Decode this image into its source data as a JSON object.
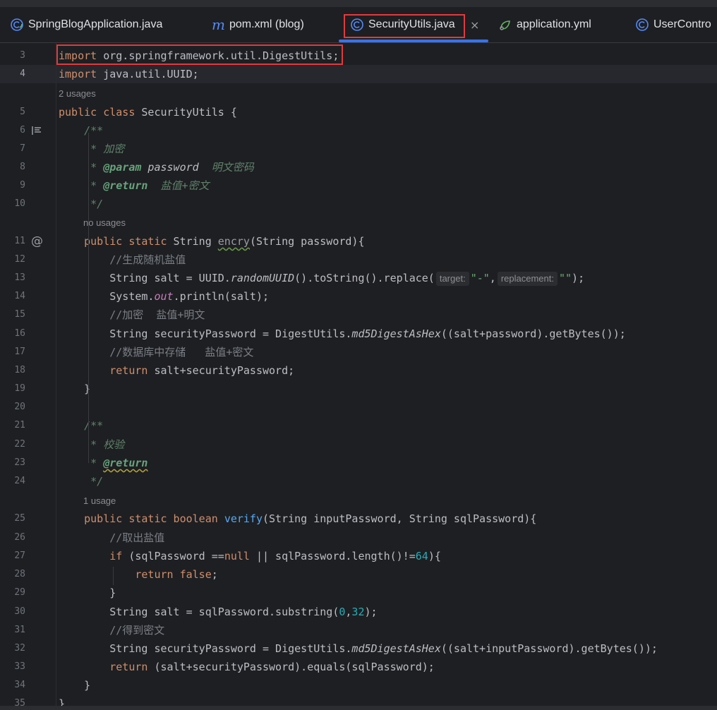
{
  "tabs": [
    {
      "label": "SpringBlogApplication.java",
      "icon": "spring-class-icon"
    },
    {
      "label": "pom.xml (blog)",
      "icon": "maven-m-icon"
    },
    {
      "label": "SecurityUtils.java",
      "icon": "class-icon",
      "active": true,
      "close": "×"
    },
    {
      "label": "application.yml",
      "icon": "spring-leaf-icon"
    },
    {
      "label": "UserContro",
      "icon": "class-icon"
    }
  ],
  "colors": {
    "accent": "#3574f0",
    "highlight": "#e03a3e",
    "keyword": "#cf8e6d",
    "comment": "#7a7e85",
    "doc": "#5f826b",
    "method": "#56a8f5",
    "number": "#2aacb8",
    "string": "#6aab73"
  },
  "lines": {
    "l3": "3",
    "l4": "4",
    "l5": "5",
    "l6": "6",
    "l7": "7",
    "l8": "8",
    "l9": "9",
    "l10": "10",
    "l11": "11",
    "l12": "12",
    "l13": "13",
    "l14": "14",
    "l15": "15",
    "l16": "16",
    "l17": "17",
    "l18": "18",
    "l19": "19",
    "l20": "20",
    "l21": "21",
    "l22": "22",
    "l23": "23",
    "l24": "24",
    "l25": "25",
    "l26": "26",
    "l27": "27",
    "l28": "28",
    "l29": "29",
    "l30": "30",
    "l31": "31",
    "l32": "32",
    "l33": "33",
    "l34": "34",
    "l35": "35"
  },
  "usages": {
    "u1": "2 usages",
    "u2": "no usages",
    "u3": "1 usage"
  },
  "code": {
    "c3_kw": "import",
    "c3_rest": " org.springframework.util.DigestUtils;",
    "c4_kw": "import",
    "c4_rest": " java.util.UUID;",
    "c5_kw": "public class",
    "c5_rest": " SecurityUtils {",
    "c6": "    /**",
    "c7": "     * 加密",
    "c8_pre": "     * ",
    "c8_tag": "@param",
    "c8_name": " password",
    "c8_desc": "  明文密码",
    "c9_pre": "     * ",
    "c9_tag": "@return",
    "c9_desc": "  盐值+密文",
    "c10": "     */",
    "c11_kw": "    public static",
    "c11_a": " String ",
    "c11_fn": "encry",
    "c11_b": "(String password){",
    "c12": "        //生成随机盐值",
    "c13_a": "        String salt = UUID.",
    "c13_it": "randomUUID",
    "c13_b": "().toString().replace(",
    "c13_h1": "target:",
    "c13_s1": "\"-\"",
    "c13_c": ",",
    "c13_h2": "replacement:",
    "c13_s2": "\"\"",
    "c13_d": ");",
    "c14_a": "        System.",
    "c14_f": "out",
    "c14_b": ".println(salt);",
    "c15": "        //加密  盐值+明文",
    "c16_a": "        String securityPassword = DigestUtils.",
    "c16_it": "md5DigestAsHex",
    "c16_b": "((salt+password).getBytes());",
    "c17": "        //数据库中存储   盐值+密文",
    "c18_kw": "        return",
    "c18_b": " salt+securityPassword;",
    "c19": "    }",
    "c21": "    /**",
    "c22": "     * 校验",
    "c23_pre": "     * ",
    "c23_tag": "@return",
    "c24": "     */",
    "c25_kw": "    public static boolean",
    "c25_sp": " ",
    "c25_fn": "verify",
    "c25_b": "(String inputPassword, String sqlPassword){",
    "c26": "        //取出盐值",
    "c27_kw": "        if",
    "c27_a": " (sqlPassword ==",
    "c27_kw2": "null",
    "c27_b": " || sqlPassword.length()!=",
    "c27_n": "64",
    "c27_c": "){",
    "c28_kw": "            return false",
    "c28_b": ";",
    "c29": "        }",
    "c30_a": "        String salt = sqlPassword.substring(",
    "c30_n1": "0",
    "c30_c": ",",
    "c30_n2": "32",
    "c30_b": ");",
    "c31": "        //得到密文",
    "c32_a": "        String securityPassword = DigestUtils.",
    "c32_it": "md5DigestAsHex",
    "c32_b": "((salt+inputPassword).getBytes());",
    "c33_kw": "        return",
    "c33_b": " (salt+securityPassword).equals(sqlPassword);",
    "c34": "    }",
    "c35": "}"
  }
}
